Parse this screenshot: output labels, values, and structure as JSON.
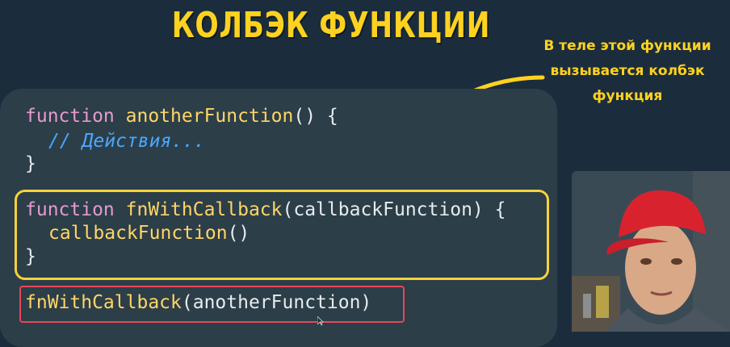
{
  "title": "КОЛБЭК ФУНКЦИИ",
  "note": {
    "line1": "В теле этой функции",
    "line2": "вызывается колбэк",
    "line3": "функция"
  },
  "code": {
    "block1": {
      "kw": "function",
      "name": "anotherFunction",
      "rest": "() {",
      "comment": "// Действия...",
      "close": "}"
    },
    "block2": {
      "kw": "function",
      "name": "fnWithCallback",
      "rest": "(callbackFunction) {",
      "indent": "  ",
      "call": "callbackFunction",
      "call_rest": "()",
      "close": "}"
    },
    "call": {
      "name": "fnWithCallback",
      "rest": "(anotherFunction)"
    }
  },
  "colors": {
    "accent": "#ffd21f",
    "background": "#1b2d3c",
    "panel": "#2c3e48",
    "highlight_yellow": "#f6d23c",
    "highlight_red": "#e8465a"
  },
  "icons": {
    "arrow": "curved-arrow-icon",
    "webcam": "presenter-webcam"
  }
}
